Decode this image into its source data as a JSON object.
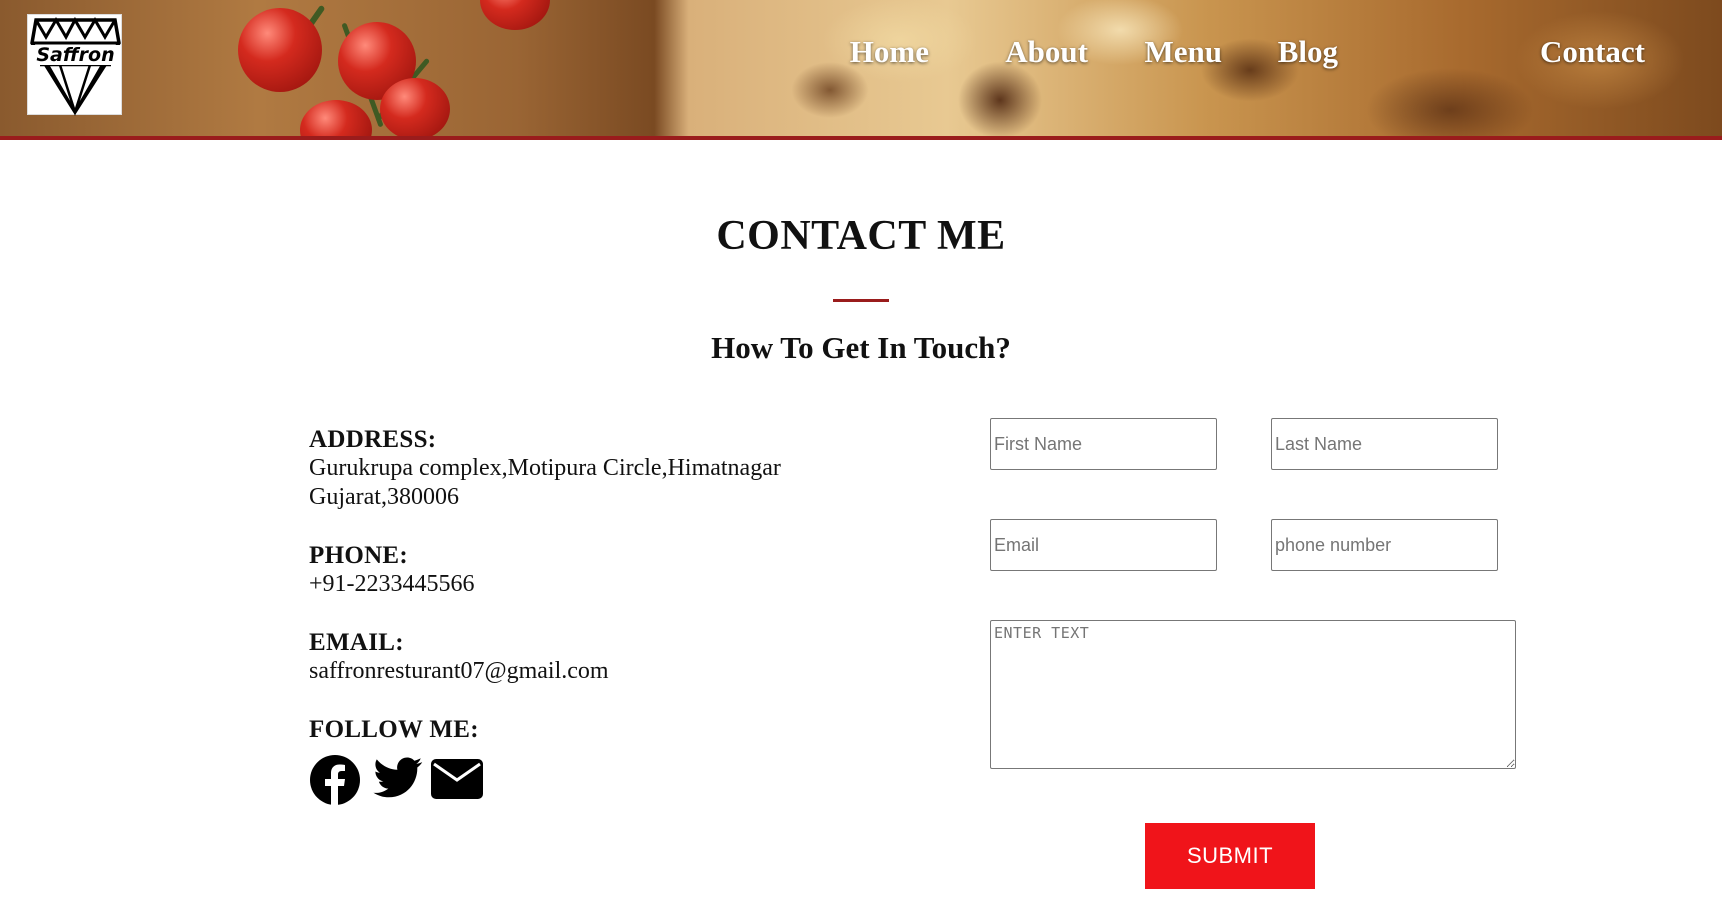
{
  "brand": {
    "logo_text": "Saffron"
  },
  "nav": {
    "items": [
      "Home",
      "About",
      "Menu",
      "Blog",
      "Contact"
    ]
  },
  "page": {
    "title": "CONTACT ME",
    "subtitle": "How To Get In Touch?"
  },
  "contact": {
    "address_label": "ADDRESS:",
    "address_line1": "Gurukrupa complex,Motipura Circle,Himatnagar",
    "address_line2": "Gujarat,380006",
    "phone_label": "PHONE:",
    "phone_value": "+91-2233445566",
    "email_label": "EMAIL:",
    "email_value": "saffronresturant07@gmail.com",
    "follow_label": "FOLLOW ME:",
    "social_icons": [
      "facebook-icon",
      "twitter-icon",
      "mail-icon"
    ]
  },
  "form": {
    "first_name_placeholder": "First Name",
    "last_name_placeholder": "Last Name",
    "email_placeholder": "Email",
    "phone_placeholder": "phone number",
    "message_placeholder": "ENTER TEXT",
    "submit_label": "SUBMIT"
  },
  "colors": {
    "accent": "#9a1c1c",
    "submit_bg": "#f0141a",
    "nav_text": "#ffffff"
  }
}
